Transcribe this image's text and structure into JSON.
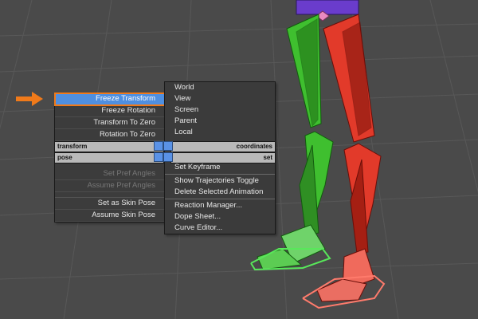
{
  "colors": {
    "viewport_bg": "#4a4a4a",
    "grid": "#5a5a5a",
    "selection": "#4f8fe0",
    "highlight": "#f07a1a",
    "left_leg": "#3fbf2f",
    "right_leg": "#e23a2a",
    "pelvis": "#6a3ccc"
  },
  "quad_menu": {
    "left_items": [
      {
        "label": "Freeze Transform",
        "state": "selected"
      },
      {
        "label": "Freeze Rotation",
        "state": "enabled"
      },
      {
        "label": "Transform To Zero",
        "state": "enabled"
      },
      {
        "label": "Rotation To Zero",
        "state": "enabled"
      },
      {
        "label": "Set Pref Angles",
        "state": "disabled"
      },
      {
        "label": "Assume Pref Angles",
        "state": "disabled"
      },
      {
        "label": "Set as Skin Pose",
        "state": "enabled"
      },
      {
        "label": "Assume Skin Pose",
        "state": "enabled"
      }
    ],
    "right_items": [
      {
        "label": "World"
      },
      {
        "label": "View"
      },
      {
        "label": "Screen"
      },
      {
        "label": "Parent"
      },
      {
        "label": "Local"
      },
      {
        "label": "Set Keyframe"
      },
      {
        "label": "Show Trajectories Toggle"
      },
      {
        "label": "Delete Selected Animation"
      },
      {
        "label": "Reaction Manager..."
      },
      {
        "label": "Dope Sheet..."
      },
      {
        "label": "Curve Editor..."
      }
    ],
    "titles": {
      "transform": "transform",
      "coordinates": "coordinates",
      "pose": "pose",
      "set": "set"
    }
  },
  "icons": {
    "pointer": "arrow-right-icon"
  }
}
